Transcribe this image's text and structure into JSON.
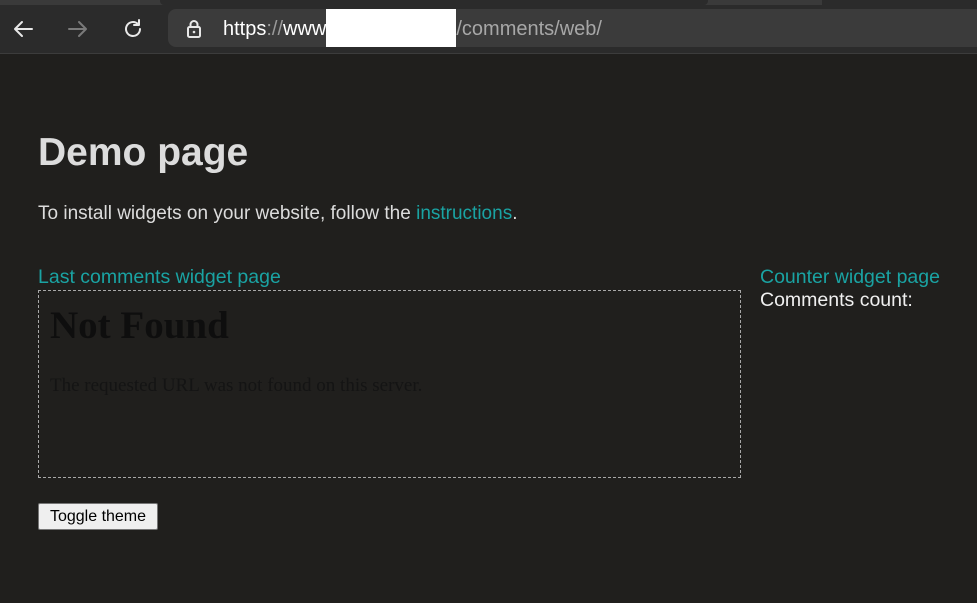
{
  "browser": {
    "url": {
      "scheme": "https",
      "separator": "://",
      "host_prefix": "www",
      "path": "/comments/web/"
    }
  },
  "page": {
    "heading": "Demo page",
    "intro_text": "To install widgets on your website, follow the ",
    "intro_link": "instructions",
    "intro_end": ".",
    "last_comments_link": "Last comments widget page",
    "counter_link": "Counter widget page",
    "comments_count_label": "Comments count:",
    "toggle_button": "Toggle theme"
  },
  "embedded_frame": {
    "title": "Not Found",
    "message": "The requested URL was not found on this server."
  },
  "colors": {
    "background": "#201f1d",
    "link": "#1aa3a3",
    "text": "#dcdcdc"
  }
}
